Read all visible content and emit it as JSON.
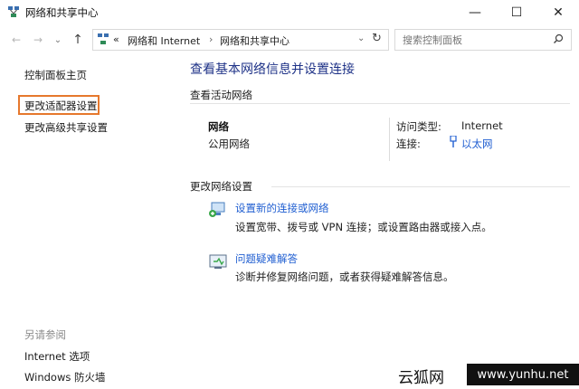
{
  "window": {
    "title": "网络和共享中心",
    "controls": {
      "minimize": "—",
      "maximize": "☐",
      "close": "✕"
    }
  },
  "navigation": {
    "back": "←",
    "forward": "→",
    "dropdown": "⌄",
    "up": "↑"
  },
  "address_bar": {
    "chevrons": "«",
    "crumbs": [
      "网络和 Internet",
      "网络和共享中心"
    ],
    "separator": "›",
    "dropdown": "⌄",
    "refresh": "↻"
  },
  "search": {
    "placeholder": "搜索控制面板",
    "icon": "search-icon"
  },
  "sidebar": {
    "items": [
      {
        "label": "控制面板主页"
      },
      {
        "label": "更改适配器设置"
      },
      {
        "label": "更改高级共享设置"
      }
    ],
    "see_also_heading": "另请参阅",
    "see_also": [
      {
        "label": "Internet 选项"
      },
      {
        "label": "Windows 防火墙"
      }
    ]
  },
  "main": {
    "title": "查看基本网络信息并设置连接",
    "active_section": "查看活动网络",
    "network": {
      "name": "网络",
      "type": "公用网络",
      "access_label": "访问类型:",
      "access_value": "Internet",
      "connection_label": "连接:",
      "connection_value": "以太网"
    },
    "change_section": "更改网络设置",
    "tasks": [
      {
        "title": "设置新的连接或网络",
        "desc": "设置宽带、拨号或 VPN 连接；或设置路由器或接入点。"
      },
      {
        "title": "问题疑难解答",
        "desc": "诊断并修复网络问题，或者获得疑难解答信息。"
      }
    ]
  },
  "watermark": {
    "logo": "云狐网",
    "url": "www.yunhu.net"
  },
  "colors": {
    "link": "#1f5ed1",
    "title": "#1e3287",
    "highlight": "#e6782d"
  }
}
